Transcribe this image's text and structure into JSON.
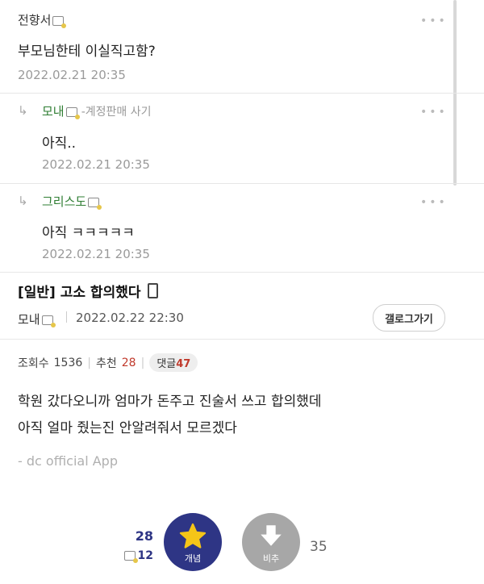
{
  "comments": [
    {
      "nick": "전향서",
      "body": "부모님한테 이실직고함?",
      "date": "2022.02.21 20:35"
    },
    {
      "nick": "모내",
      "extra": "-계정판매 사기",
      "body": "아직..",
      "date": "2022.02.21 20:35"
    },
    {
      "nick": "그리스도",
      "body": "아직 ㅋㅋㅋㅋㅋ",
      "date": "2022.02.21 20:35"
    }
  ],
  "post": {
    "title": "[일반] 고소 합의했다",
    "author": "모내",
    "date": "2022.02.22 22:30",
    "gallery_button": "갤로그가기",
    "views_label": "조회수",
    "views": "1536",
    "recommend_label": "추천",
    "recommend": "28",
    "comment_label": "댓글",
    "comment_count": "47",
    "body_line1": "학원 갔다오니까 엄마가 돈주고 진술서 쓰고 합의했데",
    "body_line2": "아직 얼마 줬는진 안알려줘서 모르겠다",
    "footer": "- dc official App"
  },
  "votes": {
    "up_count": "28",
    "up_fixed": "12",
    "up_label": "개념",
    "down_label": "비추",
    "down_count": "35",
    "up_color": "#2e3585",
    "down_color": "#a7a7a7",
    "star_color": "#f5c518"
  },
  "icons": [
    "reply-arrow-icon",
    "more-dots-icon",
    "user-badge-icon",
    "mobile-icon",
    "star-icon",
    "down-arrow-icon"
  ],
  "dots": "•••",
  "reply_arrow": "↳"
}
